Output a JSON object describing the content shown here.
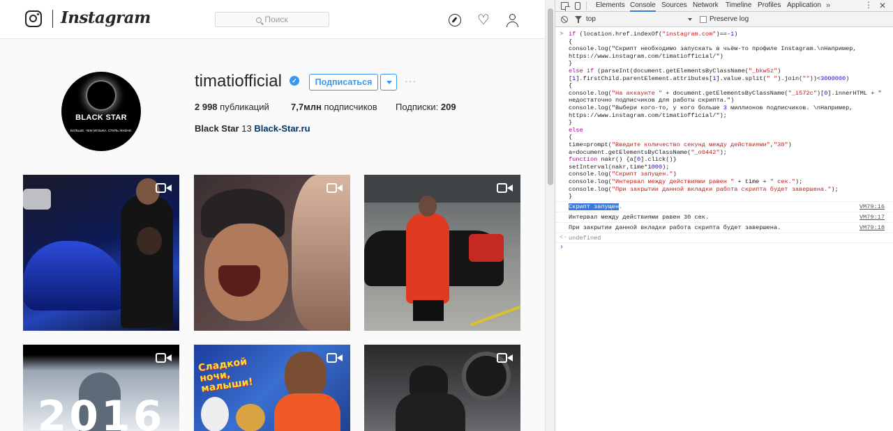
{
  "instagram": {
    "wordmark": "Instagram",
    "search_placeholder": "Поиск",
    "profile": {
      "username": "timatiofficial",
      "follow_label": "Подписаться",
      "more_label": "···",
      "avatar_brand": "BLACK STAR",
      "avatar_slogan": "БОЛЬШЕ, ЧЕМ МУЗЫКА. СТИЛЬ ЖИЗНИ.",
      "stats": [
        {
          "count": "2 998",
          "label": "публикаций"
        },
        {
          "count": "7,7млн",
          "label": "подписчиков"
        },
        {
          "count": "209",
          "label": "Подписки:"
        }
      ],
      "bio_name": "Black Star",
      "bio_number": "13",
      "bio_link": "Black-Star.ru"
    },
    "posts": [
      {
        "bg": "#1d2a6a",
        "accent": "#3050d0"
      },
      {
        "bg": "#4a3d3c",
        "accent": "#d8b39a"
      },
      {
        "bg": "#8a8a88",
        "accent": "#e23b26"
      },
      {
        "bg": "#cfd6dd",
        "accent": "#3d3d3d"
      },
      {
        "bg": "#2b59b3",
        "accent": "#f05a25"
      },
      {
        "bg": "#3c3c3e",
        "accent": "#1c1c1c"
      }
    ],
    "post_year_text": "2016",
    "post_sticker_text": "Сладкой ночи, малыши!"
  },
  "devtools": {
    "tabs": [
      "Elements",
      "Console",
      "Sources",
      "Network",
      "Timeline",
      "Profiles",
      "Application"
    ],
    "active_tab": "Console",
    "more_tabs": "»",
    "context": "top",
    "preserve_log": "Preserve log",
    "code_lines": [
      "if (location.href.indexOf(\"instagram.com\")==-1)",
      "{",
      "console.log(\"Скрипт необходимо запускать в чьём-то профиле Instagram.\\nНапример,",
      "https://www.instagram.com/timatiofficial/\")",
      "}",
      "else if (parseInt(document.getElementsByClassName(\"_bkw5z\")",
      "[1].firstChild.parentElement.attributes[1].value.split(\" \").join(\"\"))<3000000)",
      "{",
      "console.log(\"На аккаунте \" + document.getElementsByClassName(\"_i572c\")[0].innerHTML + \"",
      "недостаточно подписчиков для работы скрипта.\")",
      "console.log(\"Выбери кого-то, у кого больше 3 миллионов подписчиков. \\nНапример,",
      "https://www.instagram.com/timatiofficial/\");",
      "}",
      "else",
      "{",
      "time=prompt(\"Введите количество секунд между действиями\",\"30\")",
      "a=document.getElementsByClassName(\"_o0442\");",
      "function nakr() {a[0].click()}",
      "setInterval(nakr,time*1000);",
      "console.log(\"Скрипт запущен.\")",
      "console.log(\"Интервал между действиями равен \" + time + \" сек.\");",
      "console.log(\"При закрытии данной вкладки работа скрипта будет завершена.\");",
      "}"
    ],
    "logs": [
      {
        "selected": "Скрипт запущен",
        "rest": ".",
        "src": "VM79:16"
      },
      {
        "selected": "",
        "rest": "Интервал между действиями равен 30 сек.",
        "src": "VM79:17"
      },
      {
        "selected": "",
        "rest": "При закрытии данной вкладки работа скрипта будет завершена.",
        "src": "VM79:18"
      }
    ],
    "result": "undefined"
  }
}
